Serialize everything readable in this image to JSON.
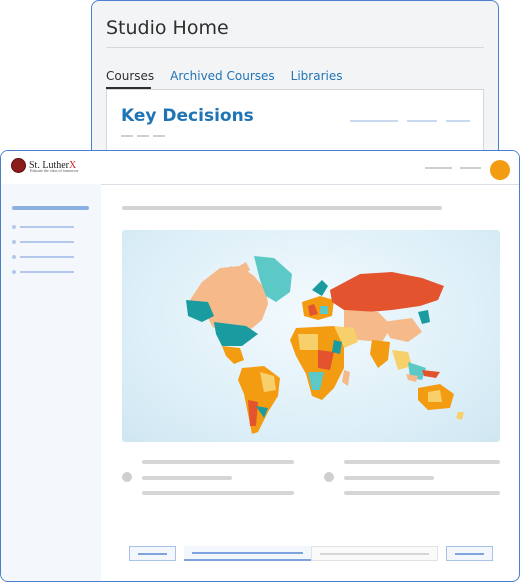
{
  "studio": {
    "title": "Studio Home",
    "tabs": [
      {
        "label": "Courses",
        "active": true
      },
      {
        "label": "Archived Courses",
        "active": false
      },
      {
        "label": "Libraries",
        "active": false
      }
    ],
    "course": {
      "title": "Key Decisions"
    }
  },
  "lms": {
    "logo": {
      "name": "St. Luther",
      "accent": "X",
      "tagline": "Educate the class of tomorrow"
    },
    "colors": {
      "accent": "#4a7fd0",
      "avatar": "#f39c12",
      "link": "#1f74b6"
    },
    "pager": {
      "progress": 0.5
    }
  }
}
